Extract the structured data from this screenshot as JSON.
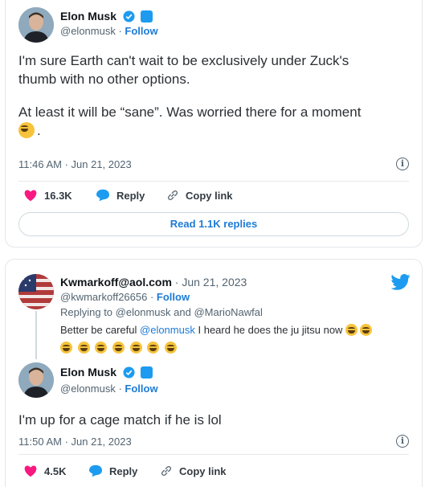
{
  "tweet1": {
    "author": {
      "name": "Elon Musk",
      "handle": "@elonmusk",
      "follow": "Follow"
    },
    "text_line1": "I'm sure Earth can't wait to be exclusively under Zuck's",
    "text_line2": "thumb with no other options.",
    "text_line3": "At least it will be “sane”. Was worried there for a moment",
    "text_line4_suffix": ".",
    "timestamp": "11:46 AM · Jun 21, 2023",
    "actions": {
      "likes": "16.3K",
      "reply": "Reply",
      "copy_link": "Copy link"
    },
    "read_replies": "Read 1.1K replies"
  },
  "tweet2": {
    "quoted": {
      "author": {
        "name": "Kwmarkoff@aol.com",
        "date": "· Jun 21, 2023",
        "handle": "@kwmarkoff26656",
        "follow": "Follow"
      },
      "replying_prefix": "Replying to",
      "replying_to_1": "@elonmusk",
      "replying_and": "and",
      "replying_to_2": "@MarioNawfal",
      "text_prefix": "Better be careful",
      "text_mention": "@elonmusk",
      "text_suffix": "I heard he does the ju jitsu now"
    },
    "author": {
      "name": "Elon Musk",
      "handle": "@elonmusk",
      "follow": "Follow"
    },
    "text": "I'm up for a cage match if he is lol",
    "timestamp": "11:50 AM · Jun 21, 2023",
    "actions": {
      "likes": "4.5K",
      "reply": "Reply",
      "copy_link": "Copy link"
    }
  },
  "colors": {
    "accent": "#1d9bf0",
    "like": "#f91880",
    "text": "#0f1419",
    "muted": "#536471"
  }
}
